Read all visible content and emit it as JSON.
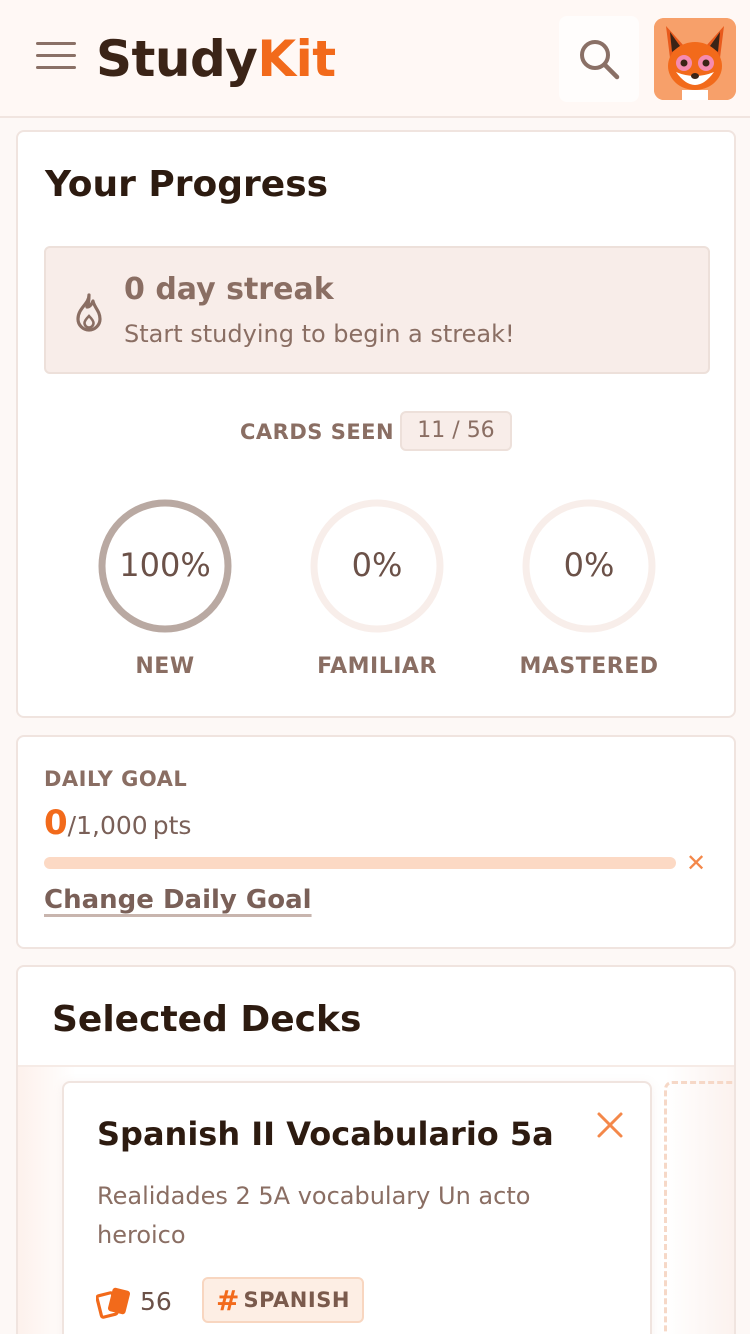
{
  "header": {
    "logo_part1": "Study",
    "logo_part2": "Kit",
    "icons": {
      "menu": "hamburger-menu-icon",
      "search": "search-icon",
      "avatar": "fox-avatar"
    }
  },
  "progress": {
    "title": "Your Progress",
    "streak": {
      "title": "0 day streak",
      "subtitle": "Start studying to begin a streak!"
    },
    "cards_seen": {
      "label": "CARDS SEEN",
      "value": "11 / 56"
    },
    "rings": [
      {
        "value": "100%",
        "label": "NEW",
        "fraction": 1.0,
        "color": "#b9a9a2"
      },
      {
        "value": "0%",
        "label": "FAMILIAR",
        "fraction": 0.0,
        "color": "#f6ebe6"
      },
      {
        "value": "0%",
        "label": "MASTERED",
        "fraction": 0.0,
        "color": "#f6ebe6"
      }
    ]
  },
  "daily_goal": {
    "label": "DAILY GOAL",
    "current": "0",
    "target": "/1,000",
    "unit": "pts",
    "progress": 0,
    "clear_symbol": "✕",
    "change_link": "Change Daily Goal"
  },
  "decks": {
    "title": "Selected Decks",
    "items": [
      {
        "title": "Spanish II Vocabulario 5a",
        "description": "Realidades 2 5A vocabulary Un acto heroico",
        "count": "56",
        "tag_hash": "#",
        "tag": "SPANISH"
      }
    ]
  },
  "colors": {
    "accent": "#f26a1b",
    "text_dark": "#2d1b10",
    "text_muted": "#8a6e63"
  }
}
